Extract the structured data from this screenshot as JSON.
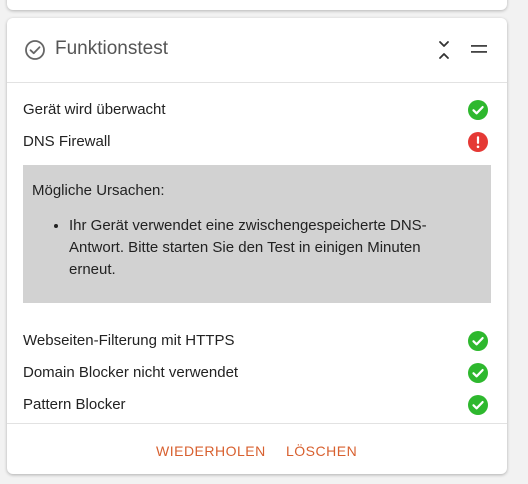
{
  "card": {
    "title": "Funktionstest",
    "title_icon": "check-circle-outline-icon",
    "header_actions": [
      "collapse-icon",
      "menu-icon"
    ]
  },
  "checks": [
    {
      "label": "Gerät wird überwacht",
      "status": "ok"
    },
    {
      "label": "DNS Firewall",
      "status": "error"
    },
    {
      "label": "Webseiten-Filterung mit HTTPS",
      "status": "ok"
    },
    {
      "label": "Domain Blocker nicht verwendet",
      "status": "ok"
    },
    {
      "label": "Pattern Blocker",
      "status": "ok"
    }
  ],
  "info": {
    "heading": "Mögliche Ursachen:",
    "causes": [
      "Ihr Gerät verwendet eine zwischengespeicherte DNS-Antwort. Bitte starten Sie den Test in einigen Minuten erneut."
    ]
  },
  "footer": {
    "retry_label": "WIEDERHOLEN",
    "delete_label": "LÖSCHEN"
  },
  "colors": {
    "ok": "#2eb82e",
    "error": "#e53935",
    "accent": "#d8602f",
    "info_bg": "#d2d2d2"
  }
}
